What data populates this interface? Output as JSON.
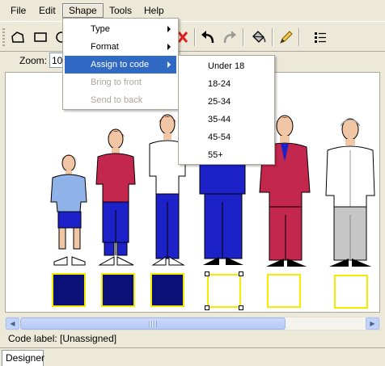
{
  "menubar": {
    "items": [
      "File",
      "Edit",
      "Shape",
      "Tools",
      "Help"
    ]
  },
  "toolbar": {
    "icons": [
      "shape-icon",
      "rectangle-icon",
      "circle-icon",
      "delete-icon",
      "undo-icon",
      "redo-icon",
      "fill-icon",
      "pencil-icon",
      "list-icon"
    ]
  },
  "zoom": {
    "label": "Zoom:",
    "value": "100%"
  },
  "shape_menu": {
    "items": [
      {
        "label": "Type",
        "submenu": true,
        "enabled": true
      },
      {
        "label": "Format",
        "submenu": true,
        "enabled": true
      },
      {
        "label": "Assign to code",
        "submenu": true,
        "enabled": true,
        "highlighted": true
      },
      {
        "label": "Bring to front",
        "submenu": false,
        "enabled": false
      },
      {
        "label": "Send to back",
        "submenu": false,
        "enabled": false
      }
    ]
  },
  "assign_submenu": {
    "items": [
      "Under 18",
      "18-24",
      "25-34",
      "35-44",
      "45-54",
      "55+"
    ]
  },
  "canvas": {
    "figures": [
      {
        "name": "child-figure",
        "shirt": "#8fb2e8",
        "pants": "#1c22c8",
        "hair": "#7a2614"
      },
      {
        "name": "teen-figure",
        "shirt": "#c3274d",
        "pants": "#1c22c8",
        "hair": "#8a2a1c"
      },
      {
        "name": "young-adult-figure",
        "shirt": "#ffffff",
        "pants": "#1c22c8",
        "hair": "#8a2a1c"
      },
      {
        "name": "adult-suit-figure",
        "shirt": "#1c22c8",
        "pants": "#1c22c8",
        "hair": "#8a2a1c"
      },
      {
        "name": "middle-aged-figure",
        "shirt": "#c3274d",
        "pants": "#c3274d",
        "hair": "#8a2a1c"
      },
      {
        "name": "senior-figure",
        "shirt": "#ffffff",
        "pants": "#c6c6c6",
        "hair": "#e6e6e6"
      }
    ],
    "code_boxes": [
      {
        "filled": true,
        "color": "#0a1077"
      },
      {
        "filled": true,
        "color": "#0a1077"
      },
      {
        "filled": true,
        "color": "#0a1077"
      },
      {
        "filled": false,
        "selected": true
      },
      {
        "filled": false
      },
      {
        "filled": false
      }
    ]
  },
  "status": {
    "code_label": "Code label: [Unassigned]"
  },
  "tabs": {
    "designer": "Designer"
  },
  "colors": {
    "menu_highlight": "#316ac5",
    "box_border": "#f4ec00",
    "box_fill": "#0a1077"
  }
}
